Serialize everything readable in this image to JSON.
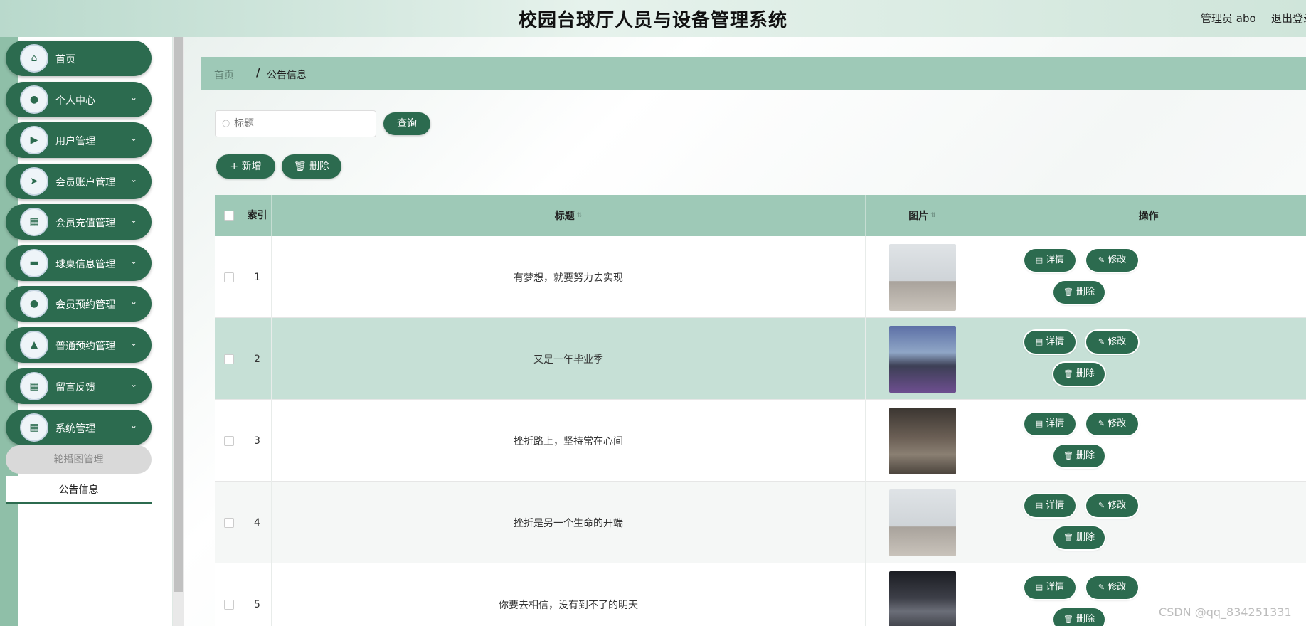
{
  "header": {
    "title": "校园台球厅人员与设备管理系统",
    "user": "管理员 abo",
    "logout": "退出登录"
  },
  "sidebar": {
    "items": [
      {
        "label": "首页",
        "icon": "home-icon",
        "glyph": "⌂",
        "expandable": false
      },
      {
        "label": "个人中心",
        "icon": "user-icon",
        "glyph": "●",
        "expandable": true
      },
      {
        "label": "用户管理",
        "icon": "video-icon",
        "glyph": "▶",
        "expandable": true
      },
      {
        "label": "会员账户管理",
        "icon": "send-icon",
        "glyph": "➤",
        "expandable": true
      },
      {
        "label": "会员充值管理",
        "icon": "grid-icon",
        "glyph": "▦",
        "expandable": true
      },
      {
        "label": "球桌信息管理",
        "icon": "chat-icon",
        "glyph": "▬",
        "expandable": true
      },
      {
        "label": "会员预约管理",
        "icon": "user-icon",
        "glyph": "●",
        "expandable": true
      },
      {
        "label": "普通预约管理",
        "icon": "user-icon",
        "glyph": "▲",
        "expandable": true
      },
      {
        "label": "留言反馈",
        "icon": "grid-icon",
        "glyph": "▦",
        "expandable": true
      },
      {
        "label": "系统管理",
        "icon": "grid-icon",
        "glyph": "▦",
        "expandable": true
      }
    ],
    "sub_items": [
      {
        "label": "轮播图管理"
      },
      {
        "label": "公告信息"
      }
    ]
  },
  "breadcrumb": {
    "home": "首页",
    "separator": "/",
    "current": "公告信息"
  },
  "search": {
    "placeholder": "标题",
    "query_label": "查询"
  },
  "toolbar": {
    "add_label": "+ 新增",
    "delete_label": "🗑 删除"
  },
  "table": {
    "columns": {
      "index": "索引",
      "title": "标题",
      "image": "图片",
      "actions": "操作"
    },
    "rows": [
      {
        "index": "1",
        "title": "有梦想，就要努力去实现",
        "image": "aerial-yoga-photo"
      },
      {
        "index": "2",
        "title": "又是一年毕业季",
        "image": "gym-trainer-photo"
      },
      {
        "index": "3",
        "title": "挫折路上，坚持常在心间",
        "image": "gym-room-photo"
      },
      {
        "index": "4",
        "title": "挫折是另一个生命的开端",
        "image": "aerial-yoga-photo"
      },
      {
        "index": "5",
        "title": "你要去相信，没有到不了的明天",
        "image": "dark-gym-photo"
      }
    ],
    "actions": {
      "detail": "详情",
      "edit": "修改",
      "delete": "删除"
    }
  },
  "watermark": "CSDN @qq_834251331",
  "colors": {
    "primary": "#2c6b4f",
    "header_row": "#9ec9b7",
    "highlight_row": "#c6e0d6"
  }
}
